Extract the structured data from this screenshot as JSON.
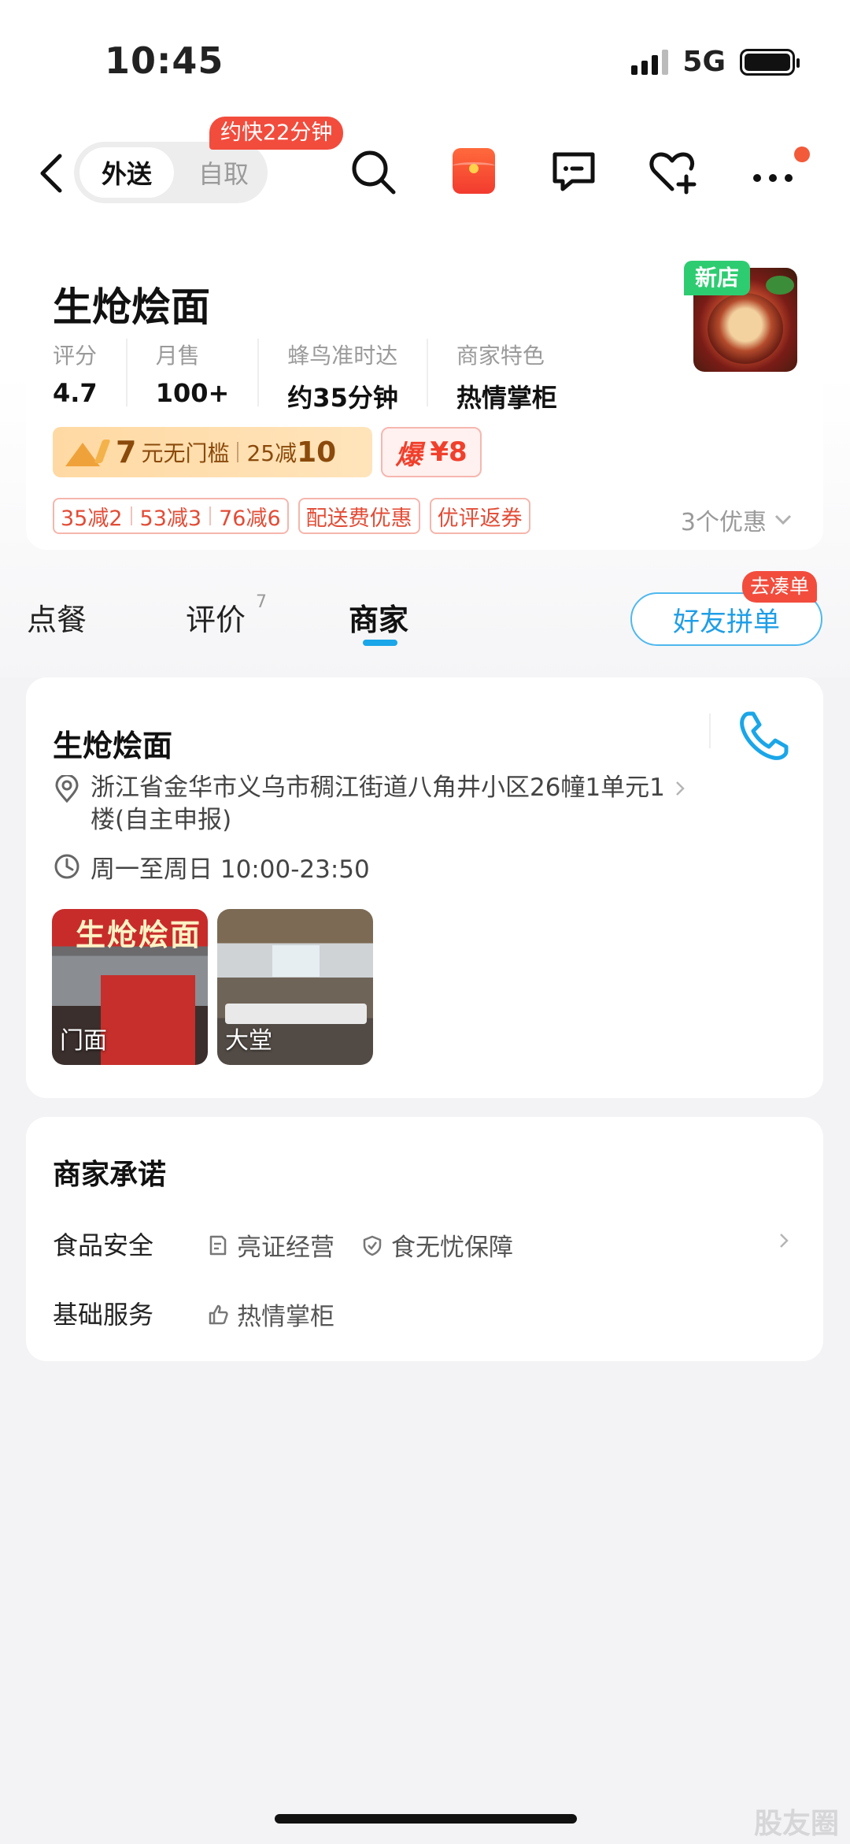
{
  "status_bar": {
    "time": "10:45",
    "network": "5G"
  },
  "nav": {
    "delivery_label": "外送",
    "pickup_label": "自取",
    "faster_badge": "约快22分钟"
  },
  "store": {
    "name": "生炝烩面",
    "new_tag": "新店",
    "stats": [
      {
        "label": "评分",
        "value": "4.7"
      },
      {
        "label": "月售",
        "value": "100+"
      },
      {
        "label": "蜂鸟准时达",
        "value": "约35分钟"
      },
      {
        "label": "商家特色",
        "value": "热情掌柜"
      }
    ],
    "promo": {
      "amount": "7",
      "text": "元无门槛",
      "deal_prefix": "25减",
      "deal_amount": "10"
    },
    "bomb": {
      "word": "爆",
      "amount": "¥8"
    },
    "coupons": {
      "full_reductions": [
        "35减2",
        "53减3",
        "76减6"
      ],
      "delivery": "配送费优惠",
      "review": "优评返券"
    },
    "more_offers": "3个优惠"
  },
  "tabs": {
    "order": "点餐",
    "reviews": "评价",
    "reviews_count": "7",
    "merchant": "商家",
    "group_button": "好友拼单",
    "group_tag": "去凑单"
  },
  "merchant_info": {
    "name": "生炝烩面",
    "address": "浙江省金华市义乌市稠江街道八角井小区26幢1单元1楼(自主申报)",
    "hours": "周一至周日 10:00-23:50",
    "photos": [
      {
        "label": "门面",
        "sign_text": "生炝烩面"
      },
      {
        "label": "大堂"
      }
    ]
  },
  "promises": {
    "title": "商家承诺",
    "food_safety_label": "食品安全",
    "food_safety_items": [
      "亮证经营",
      "食无忧保障"
    ],
    "basic_service_label": "基础服务",
    "basic_service_items": [
      "热情掌柜"
    ]
  },
  "watermark": "股友圈",
  "colors": {
    "accent_blue": "#1aa6e8",
    "promo_red": "#f24c3d",
    "new_green": "#2ecc71"
  }
}
